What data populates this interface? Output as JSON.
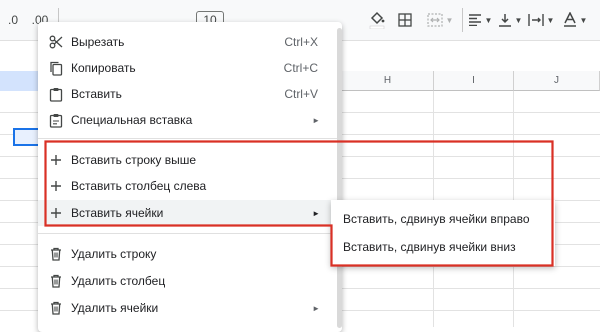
{
  "toolbar": {
    "decimal_decrease": ".0",
    "decimal_increase": ".00",
    "font_size": "10",
    "accent_color": "#1a73e8"
  },
  "columns": {
    "h": "H",
    "i": "I",
    "j": "J"
  },
  "context_menu": {
    "items": [
      {
        "label": "Вырезать",
        "shortcut": "Ctrl+X",
        "icon": "scissors-icon"
      },
      {
        "label": "Копировать",
        "shortcut": "Ctrl+C",
        "icon": "copy-icon"
      },
      {
        "label": "Вставить",
        "shortcut": "Ctrl+V",
        "icon": "paste-icon"
      },
      {
        "label": "Специальная вставка",
        "shortcut": "",
        "icon": "paste-special-icon"
      },
      {
        "label": "Вставить строку выше",
        "shortcut": "",
        "icon": "plus-icon"
      },
      {
        "label": "Вставить столбец слева",
        "shortcut": "",
        "icon": "plus-icon"
      },
      {
        "label": "Вставить ячейки",
        "shortcut": "",
        "icon": "plus-icon"
      },
      {
        "label": "Удалить строку",
        "shortcut": "",
        "icon": "trash-icon"
      },
      {
        "label": "Удалить столбец",
        "shortcut": "",
        "icon": "trash-icon"
      },
      {
        "label": "Удалить ячейки",
        "shortcut": "",
        "icon": "trash-icon"
      }
    ]
  },
  "submenu": {
    "items": [
      {
        "label": "Вставить, сдвинув ячейки вправо"
      },
      {
        "label": "Вставить, сдвинув ячейки вниз"
      }
    ]
  },
  "annotation_color": "#d93025"
}
